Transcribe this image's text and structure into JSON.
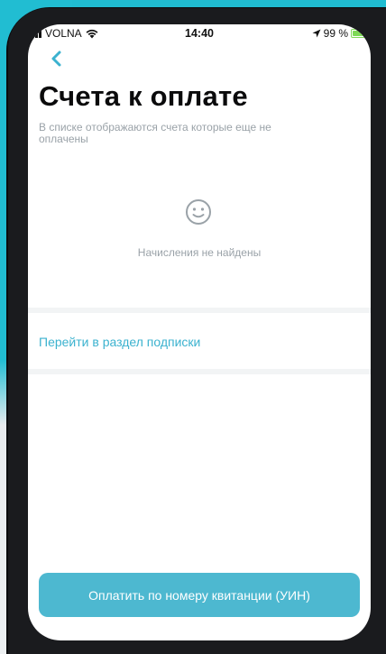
{
  "status_bar": {
    "carrier": "VOLNA",
    "time": "14:40",
    "battery": "99 %"
  },
  "nav": {
    "back_icon": "chevron-left-icon"
  },
  "header": {
    "title": "Счета к оплате",
    "subtitle": "В списке отображаются счета которые еще не оплачены"
  },
  "empty_state": {
    "icon": "smiley-icon",
    "message": "Начисления не найдены"
  },
  "links": {
    "subscriptions": "Перейти в раздел подписки"
  },
  "actions": {
    "pay_by_uin": "Оплатить по номеру квитанции (УИН)"
  },
  "colors": {
    "accent": "#3bb2cf",
    "button": "#4db8d0",
    "background_teal": "#20bcd1"
  }
}
